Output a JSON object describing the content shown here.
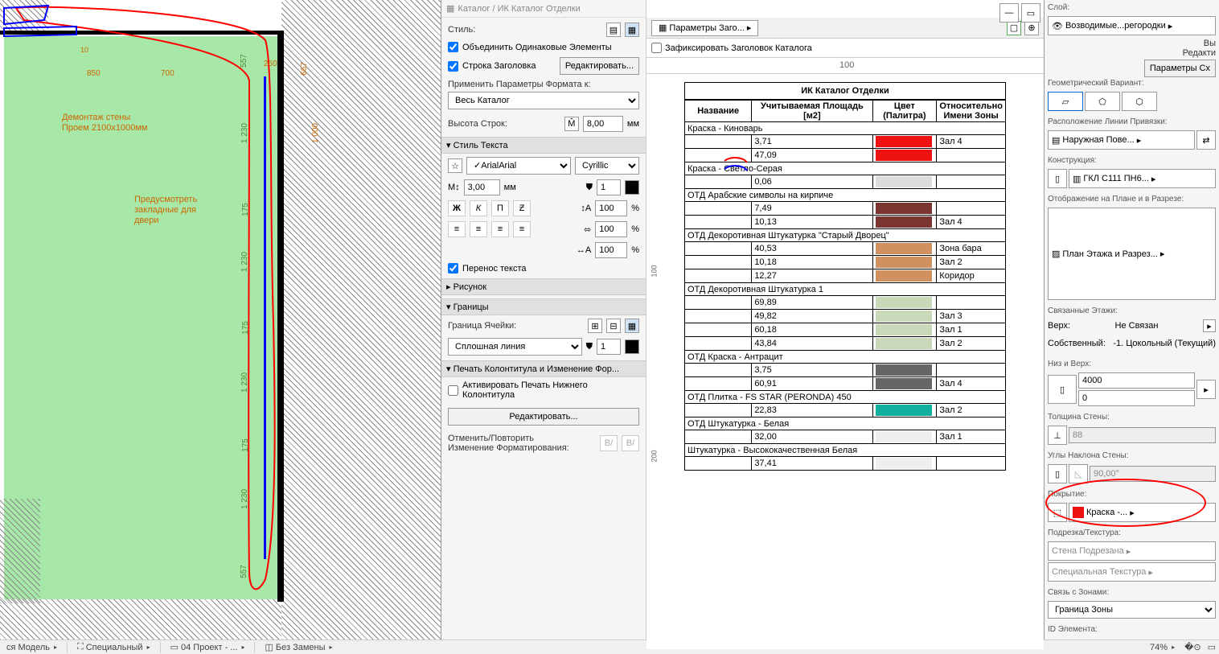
{
  "floorplan": {
    "annot1_line1": "Демонтаж стены",
    "annot1_line2": "Проем 2100х1000мм",
    "annot2_line1": "Предусмотреть",
    "annot2_line2": "закладные для",
    "annot2_line3": "двери",
    "dims": {
      "d850": "850",
      "d700": "700",
      "d10": "10",
      "d260": "260",
      "d557": "557",
      "d667": "667",
      "d1230a": "1 230",
      "d1000": "1 000",
      "d175a": "175",
      "d1230b": "1 230",
      "d175b": "175",
      "d1230c": "1 230",
      "d175c": "175",
      "d1230d": "1 230",
      "d557b": "557"
    }
  },
  "catalog": {
    "title": "Каталог / ИК Каталог Отделки",
    "style_lbl": "Стиль:",
    "merge_cb": "Объединить Одинаковые Элементы",
    "header_cb": "Строка Заголовка",
    "edit_btn": "Редактировать...",
    "apply_lbl": "Применить Параметры Формата к:",
    "apply_val": "Весь Каталог",
    "rowheight_lbl": "Высота Строк:",
    "rowheight_val": "8,00",
    "mm": "мм",
    "textstyle_hdr": "Стиль Текста",
    "font": "Arial",
    "encoding": "Cyrillic",
    "size": "3,00",
    "pen": "1",
    "bold": "Ж",
    "italic": "К",
    "underline": "П",
    "strike": "Ƶ",
    "spacing": "100",
    "pct": "%",
    "wrap_cb": "Перенос текста",
    "pic_hdr": "Рисунок",
    "border_hdr": "Границы",
    "cellborder_lbl": "Граница Ячейки:",
    "linestyle": "Сплошная линия",
    "border_pen": "1",
    "footer_hdr": "Печать Колонтитула и Изменение Фор...",
    "footer_cb": "Активировать Печать Нижнего Колонтитула",
    "edit2": "Редактировать...",
    "undo_lbl1": "Отменить/Повторить",
    "undo_lbl2": "Изменение Форматирования:",
    "undo_b1": "B/",
    "undo_b2": "B/"
  },
  "preview": {
    "params_btn": "Параметры Заго...",
    "lock_cb": "Зафиксировать Заголовок Каталога",
    "ruler100": "100",
    "title": "ИК Каталог Отделки",
    "h1": "Название",
    "h2": "Учитываемая Площадь [м2]",
    "h3": "Цвет (Палитра)",
    "h4": "Относительно Имени Зоны",
    "rows": [
      {
        "g": "Краска - Киноварь"
      },
      {
        "a": "3,71",
        "c": "#e11",
        "z": "Зал 4"
      },
      {
        "a": "47,09",
        "c": "#e11",
        "z": ""
      },
      {
        "g": "Краска - Светло-Серая"
      },
      {
        "a": "0,06",
        "c": "#ddd",
        "z": ""
      },
      {
        "g": "ОТД Арабские символы на кирпиче"
      },
      {
        "a": "7,49",
        "c": "#7a3530",
        "z": ""
      },
      {
        "a": "10,13",
        "c": "#7a3530",
        "z": "Зал 4"
      },
      {
        "g": "ОТД Декоротивная Штукатурка \"Старый Дворец\""
      },
      {
        "a": "40,53",
        "c": "#d09060",
        "z": "Зона бара"
      },
      {
        "a": "10,18",
        "c": "#d09060",
        "z": "Зал 2"
      },
      {
        "a": "12,27",
        "c": "#d09060",
        "z": "Коридор"
      },
      {
        "g": "ОТД Декоротивная Штукатурка 1"
      },
      {
        "a": "69,89",
        "c": "#c8d8b8",
        "z": ""
      },
      {
        "a": "49,82",
        "c": "#c8d8b8",
        "z": "Зал 3"
      },
      {
        "a": "60,18",
        "c": "#c8d8b8",
        "z": "Зал 1"
      },
      {
        "a": "43,84",
        "c": "#c8d8b8",
        "z": "Зал 2"
      },
      {
        "g": "ОТД Краска - Антрацит"
      },
      {
        "a": "3,75",
        "c": "#666",
        "z": ""
      },
      {
        "a": "60,91",
        "c": "#666",
        "z": "Зал 4"
      },
      {
        "g": "ОТД Плитка - FS STAR (PERONDA) 450"
      },
      {
        "a": "22,83",
        "c": "#10b0a0",
        "z": "Зал 2"
      },
      {
        "g": "ОТД Штукатурка - Белая"
      },
      {
        "a": "32,00",
        "c": "#eee",
        "z": "Зал 1"
      },
      {
        "g": "Штукатурка - Высококачественная Белая"
      },
      {
        "a": "37,41",
        "c": "#eee",
        "z": ""
      }
    ],
    "side100": "100",
    "side200": "200",
    "zoom": "74%"
  },
  "props": {
    "layer_lbl": "Слой:",
    "layer_val": "Возводимые...регородки",
    "vy": "Вы",
    "edit": "Редакти",
    "params_btn": "Параметры Сх",
    "geovar_lbl": "Геометрический Вариант:",
    "refline_lbl": "Расположение Линии Привязки:",
    "refline_val": "Наружная Пове...",
    "struct_lbl": "Конструкция:",
    "struct_val": "ГКЛ С111 ПН6...",
    "display_lbl": "Отображение на Плане и в Разрезе:",
    "display_val": "План Этажа и Разрез...",
    "linked_lbl": "Связанные Этажи:",
    "top_lbl": "Верх:",
    "top_val": "Не Связан",
    "own_lbl": "Собственный:",
    "own_val": "-1. Цокольный (Текущий)",
    "bottop_lbl": "Низ и Верх:",
    "h1": "4000",
    "h2": "0",
    "thick_lbl": "Толщина Стены:",
    "thick_val": "88",
    "angle_lbl": "Углы Наклона Стены:",
    "angle_val": "90,00°",
    "coating_lbl": "Покрытие:",
    "coating_val": "Краска -...",
    "trim_lbl": "Подрезка/Текстура:",
    "trim1": "Стена Подрезана",
    "trim2": "Специальная Текстура",
    "zones_lbl": "Связь с Зонами:",
    "zones_val": "Граница Зоны",
    "elemid_lbl": "ID Элемента:"
  },
  "statusbar": {
    "s1": "ся Модель",
    "s2": "Специальный",
    "s3": "04 Проект - ...",
    "s4": "Без Замены"
  }
}
